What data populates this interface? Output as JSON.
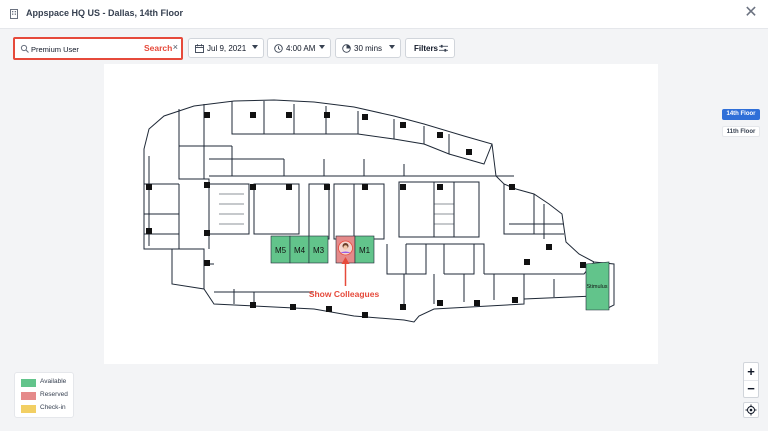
{
  "header": {
    "title": "Appspace HQ US - Dallas, 14th Floor",
    "close_icon": "close-icon",
    "building_icon": "building-icon"
  },
  "toolbar": {
    "search_value": "Premium User",
    "search_annotation": "Search",
    "clear_glyph": "×",
    "date_label": "Jul 9, 2021",
    "time_label": "4:00 AM",
    "duration_label": "30 mins",
    "filters_label": "Filters"
  },
  "map": {
    "rooms": [
      {
        "label": "M5",
        "status": "Available"
      },
      {
        "label": "M4",
        "status": "Available"
      },
      {
        "label": "M3",
        "status": "Available"
      },
      {
        "label": "M2",
        "status": "Reserved"
      },
      {
        "label": "M1",
        "status": "Available"
      },
      {
        "label": "Stimulus",
        "status": "Available"
      }
    ],
    "annotation": "Show Colleagues"
  },
  "floors": [
    {
      "label": "14th Floor",
      "active": true
    },
    {
      "label": "11th Floor",
      "active": false
    }
  ],
  "legend": [
    {
      "label": "Available",
      "color": "#62c48b"
    },
    {
      "label": "Reserved",
      "color": "#e58a8a"
    },
    {
      "label": "Check-in",
      "color": "#f2cf63"
    }
  ],
  "zoom": {
    "in": "+",
    "out": "−"
  },
  "colors": {
    "accent": "#2f6fd8",
    "annotation_red": "#e64a3b",
    "available": "#62c48b",
    "reserved": "#e58a8a",
    "checkin": "#f2cf63"
  }
}
